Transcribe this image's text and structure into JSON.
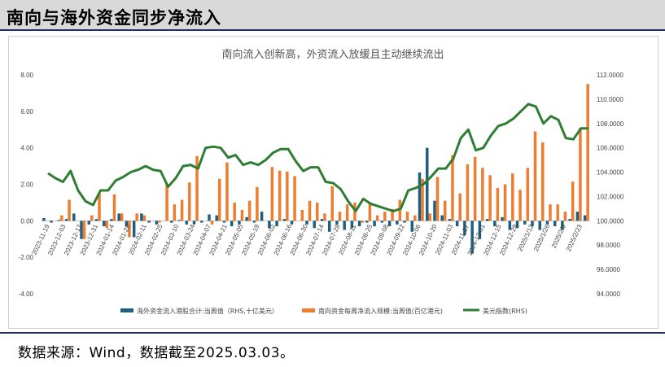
{
  "header": {
    "title": "南向与海外资金同步净流入"
  },
  "footer": {
    "source": "数据来源：Wind，数据截至2025.03.03。"
  },
  "chart_data": {
    "type": "bar",
    "title": "南向流入创新高，外资流入放缓且主动继续流出",
    "colors": {
      "foreign": "#1f5f7f",
      "southbound": "#ed7d31",
      "usd": "#2e7d32"
    },
    "y_left": {
      "ylim": [
        -4,
        8
      ],
      "ticks": [
        "-4.00",
        "-2.00",
        "0.00",
        "2.00",
        "4.00",
        "6.00",
        "8.00"
      ]
    },
    "y_right": {
      "ylim": [
        94,
        112
      ],
      "ticks": [
        "94.0000",
        "96.0000",
        "98.0000",
        "100.0000",
        "102.0000",
        "104.0000",
        "106.0000",
        "108.0000",
        "110.0000",
        "112.0000"
      ]
    },
    "x_tick_labels": [
      "2023-11-19",
      "2023-12-03",
      "2023-12-17",
      "2023-12-31",
      "2024-01-14",
      "2024-01-28",
      "2024-02-11",
      "2024-02-25",
      "2024-03-10",
      "2024-03-24",
      "2024-04-07",
      "2024-04-21",
      "2024-05-05",
      "2024-05-19",
      "2024-06-02",
      "2024-06-16",
      "2024-06-30",
      "2024-07-14",
      "2024-07-28",
      "2024-08-11",
      "2024-08-25",
      "2024-09-08",
      "2024-09-22",
      "2024-10-06",
      "2024-10-20",
      "2024-11-03",
      "2024-11-17",
      "2024-12-01",
      "2024-12-15",
      "2024-12-29",
      "2025/1/12",
      "2025/1/26",
      "2025/2/9",
      "2025/2/23"
    ],
    "series": [
      {
        "name": "海外资金流入港股合计:当周值（RHS,十亿美元）",
        "type": "bar",
        "axis": "left",
        "values": [
          0.15,
          -0.1,
          0.05,
          0.1,
          0.4,
          -1.0,
          -0.2,
          0.1,
          -0.3,
          0.1,
          0.4,
          -0.3,
          -0.9,
          0.4,
          -0.1,
          -0.2,
          0.0,
          -0.1,
          0.05,
          -0.2,
          -0.2,
          -0.1,
          0.35,
          0.3,
          -0.1,
          -0.3,
          -0.2,
          0.2,
          -0.1,
          0.5,
          -0.4,
          -0.3,
          0.1,
          -0.2,
          0.0,
          -0.2,
          -0.4,
          0.1,
          -0.6,
          -0.2,
          -0.5,
          -0.4,
          -0.3,
          -0.1,
          -0.3,
          -0.1,
          -0.3,
          -0.2,
          -0.1,
          -0.6,
          2.65,
          4.0,
          1.1,
          0.3,
          0.1,
          -0.3,
          -0.8,
          -1.8,
          -1.0,
          0.1,
          -0.3,
          0.2,
          -0.5,
          -0.4,
          -0.2,
          -0.3,
          -0.5,
          -0.2,
          -0.3,
          -0.5,
          0.1,
          0.5,
          0.3
        ]
      },
      {
        "name": "南向资金每周净流入规模:当周值(百亿港元)",
        "type": "bar",
        "axis": "left",
        "values": [
          0.0,
          0.0,
          0.3,
          1.15,
          0.0,
          -1.0,
          0.3,
          1.5,
          -0.4,
          1.45,
          0.4,
          -0.9,
          0.4,
          0.3,
          0.0,
          -0.1,
          2.0,
          0.9,
          1.15,
          2.1,
          3.55,
          0.0,
          -0.2,
          2.3,
          3.2,
          1.0,
          0.6,
          1.1,
          1.85,
          0.0,
          2.95,
          2.75,
          2.7,
          2.45,
          0.6,
          1.1,
          1.0,
          0.4,
          1.9,
          0.5,
          0.9,
          1.0,
          -0.1,
          1.0,
          0.3,
          0.5,
          0.65,
          1.15,
          0.5,
          0.3,
          2.3,
          0.4,
          2.4,
          1.1,
          3.6,
          1.5,
          3.1,
          3.5,
          2.9,
          2.5,
          1.8,
          2.0,
          2.6,
          1.7,
          2.9,
          4.9,
          4.3,
          0.9,
          0.9,
          0.5,
          2.15,
          5.1,
          7.5
        ]
      },
      {
        "name": "美元指数(RHS)",
        "type": "line",
        "axis": "right",
        "values": [
          103.9,
          103.5,
          103.2,
          104.1,
          102.5,
          101.6,
          101.3,
          102.5,
          102.5,
          103.3,
          103.6,
          104.0,
          104.2,
          104.5,
          104.2,
          104.1,
          102.8,
          103.5,
          104.5,
          104.6,
          104.3,
          106.0,
          106.1,
          106.0,
          105.2,
          105.4,
          104.6,
          104.8,
          104.6,
          105.0,
          105.6,
          105.9,
          105.9,
          104.9,
          104.1,
          104.4,
          104.4,
          103.2,
          103.1,
          102.6,
          101.6,
          100.8,
          101.8,
          101.4,
          101.2,
          101.0,
          100.8,
          101.0,
          102.5,
          102.7,
          103.0,
          103.6,
          104.3,
          104.3,
          105.1,
          106.8,
          107.5,
          105.8,
          106.0,
          107.0,
          107.8,
          108.0,
          108.4,
          109.0,
          109.6,
          109.4,
          108.0,
          108.6,
          108.3,
          106.8,
          106.7,
          107.6,
          107.6
        ]
      }
    ],
    "legend_position": "bottom",
    "grid": false
  }
}
